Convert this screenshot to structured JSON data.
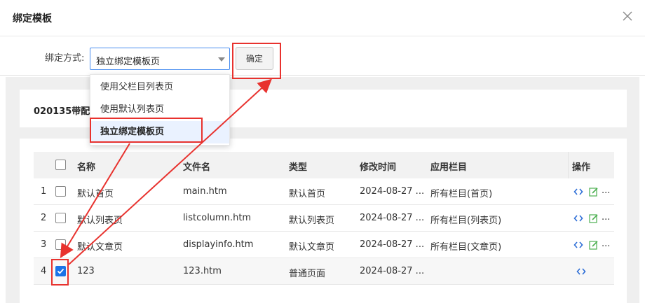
{
  "dialog": {
    "title": "绑定模板"
  },
  "bind": {
    "label": "绑定方式:",
    "selected": "独立绑定模板页",
    "options": [
      "使用父栏目列表页",
      "使用默认列表页",
      "独立绑定模板页"
    ],
    "confirm_label": "确定"
  },
  "card": {
    "name": "020135带配置"
  },
  "table": {
    "headers": {
      "name": "名称",
      "file": "文件名",
      "type": "类型",
      "modified": "修改时间",
      "column": "应用栏目",
      "actions": "操作"
    },
    "rows": [
      {
        "index": "1",
        "name": "默认首页",
        "file": "main.htm",
        "type": "默认首页",
        "modified": "2024-08-27 ...",
        "column": "所有栏目(首页)",
        "checked": false,
        "more": "..."
      },
      {
        "index": "2",
        "name": "默认列表页",
        "file": "listcolumn.htm",
        "type": "默认列表页",
        "modified": "2024-08-27 ...",
        "column": "所有栏目(列表页)",
        "checked": false,
        "more": "..."
      },
      {
        "index": "3",
        "name": "默认文章页",
        "file": "displayinfo.htm",
        "type": "默认文章页",
        "modified": "2024-08-27 ...",
        "column": "所有栏目(文章页)",
        "checked": false,
        "more": "..."
      },
      {
        "index": "4",
        "name": "123",
        "file": "123.htm",
        "type": "普通页面",
        "modified": "2024-08-27 ...",
        "column": "",
        "checked": true,
        "more": ""
      }
    ]
  },
  "icons": {
    "close": "close-icon",
    "dropdown": "chevron-down-icon",
    "code": "code-icon",
    "edit": "edit-icon",
    "check": "check-icon"
  },
  "colors": {
    "accent": "#1a73e8",
    "highlight": "#e8322e",
    "code_icon": "#2b6cd6",
    "edit_icon": "#4caf50"
  }
}
